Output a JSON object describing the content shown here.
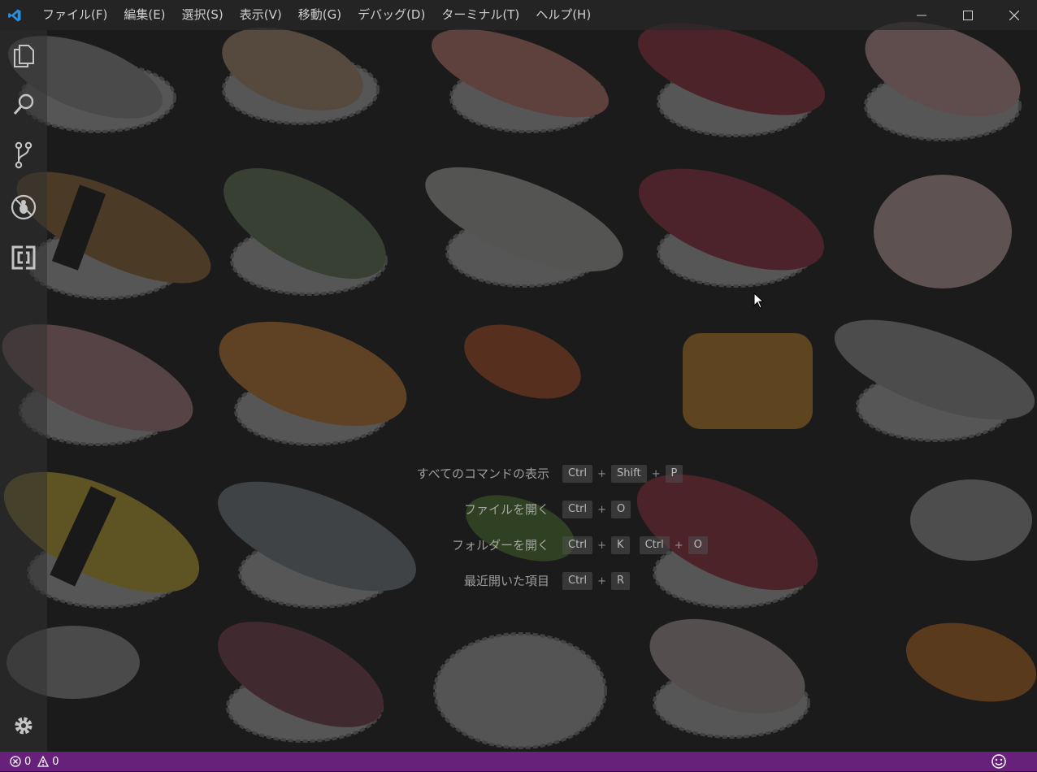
{
  "titlebar": {
    "menus": [
      {
        "label": "ファイル(F)"
      },
      {
        "label": "編集(E)"
      },
      {
        "label": "選択(S)"
      },
      {
        "label": "表示(V)"
      },
      {
        "label": "移動(G)"
      },
      {
        "label": "デバッグ(D)"
      },
      {
        "label": "ターミナル(T)"
      },
      {
        "label": "ヘルプ(H)"
      }
    ],
    "logo_icon": "vscode-logo-icon",
    "window_controls": [
      "minimize-icon",
      "maximize-icon",
      "close-icon"
    ]
  },
  "activitybar": {
    "items": [
      {
        "icon": "files-icon"
      },
      {
        "icon": "search-icon"
      },
      {
        "icon": "source-control-icon"
      },
      {
        "icon": "debug-icon"
      },
      {
        "icon": "extensions-icon"
      }
    ],
    "bottom": {
      "icon": "gear-icon"
    }
  },
  "watermark": {
    "entries": [
      {
        "label": "すべてのコマンドの表示",
        "keys": [
          "Ctrl",
          "Shift",
          "P"
        ]
      },
      {
        "label": "ファイルを開く",
        "keys": [
          "Ctrl",
          "O"
        ]
      },
      {
        "label": "フォルダーを開く",
        "keys": [
          "Ctrl",
          "K"
        ],
        "keys2": [
          "Ctrl",
          "O"
        ]
      },
      {
        "label": "最近開いた項目",
        "keys": [
          "Ctrl",
          "R"
        ]
      }
    ]
  },
  "statusbar": {
    "errors": "0",
    "warnings": "0",
    "feedback_icon": "smiley-icon",
    "background": "#68217a"
  },
  "theme": {
    "editor_background": "#1e1e1e",
    "wallpaper": "sushi-illustrations"
  }
}
